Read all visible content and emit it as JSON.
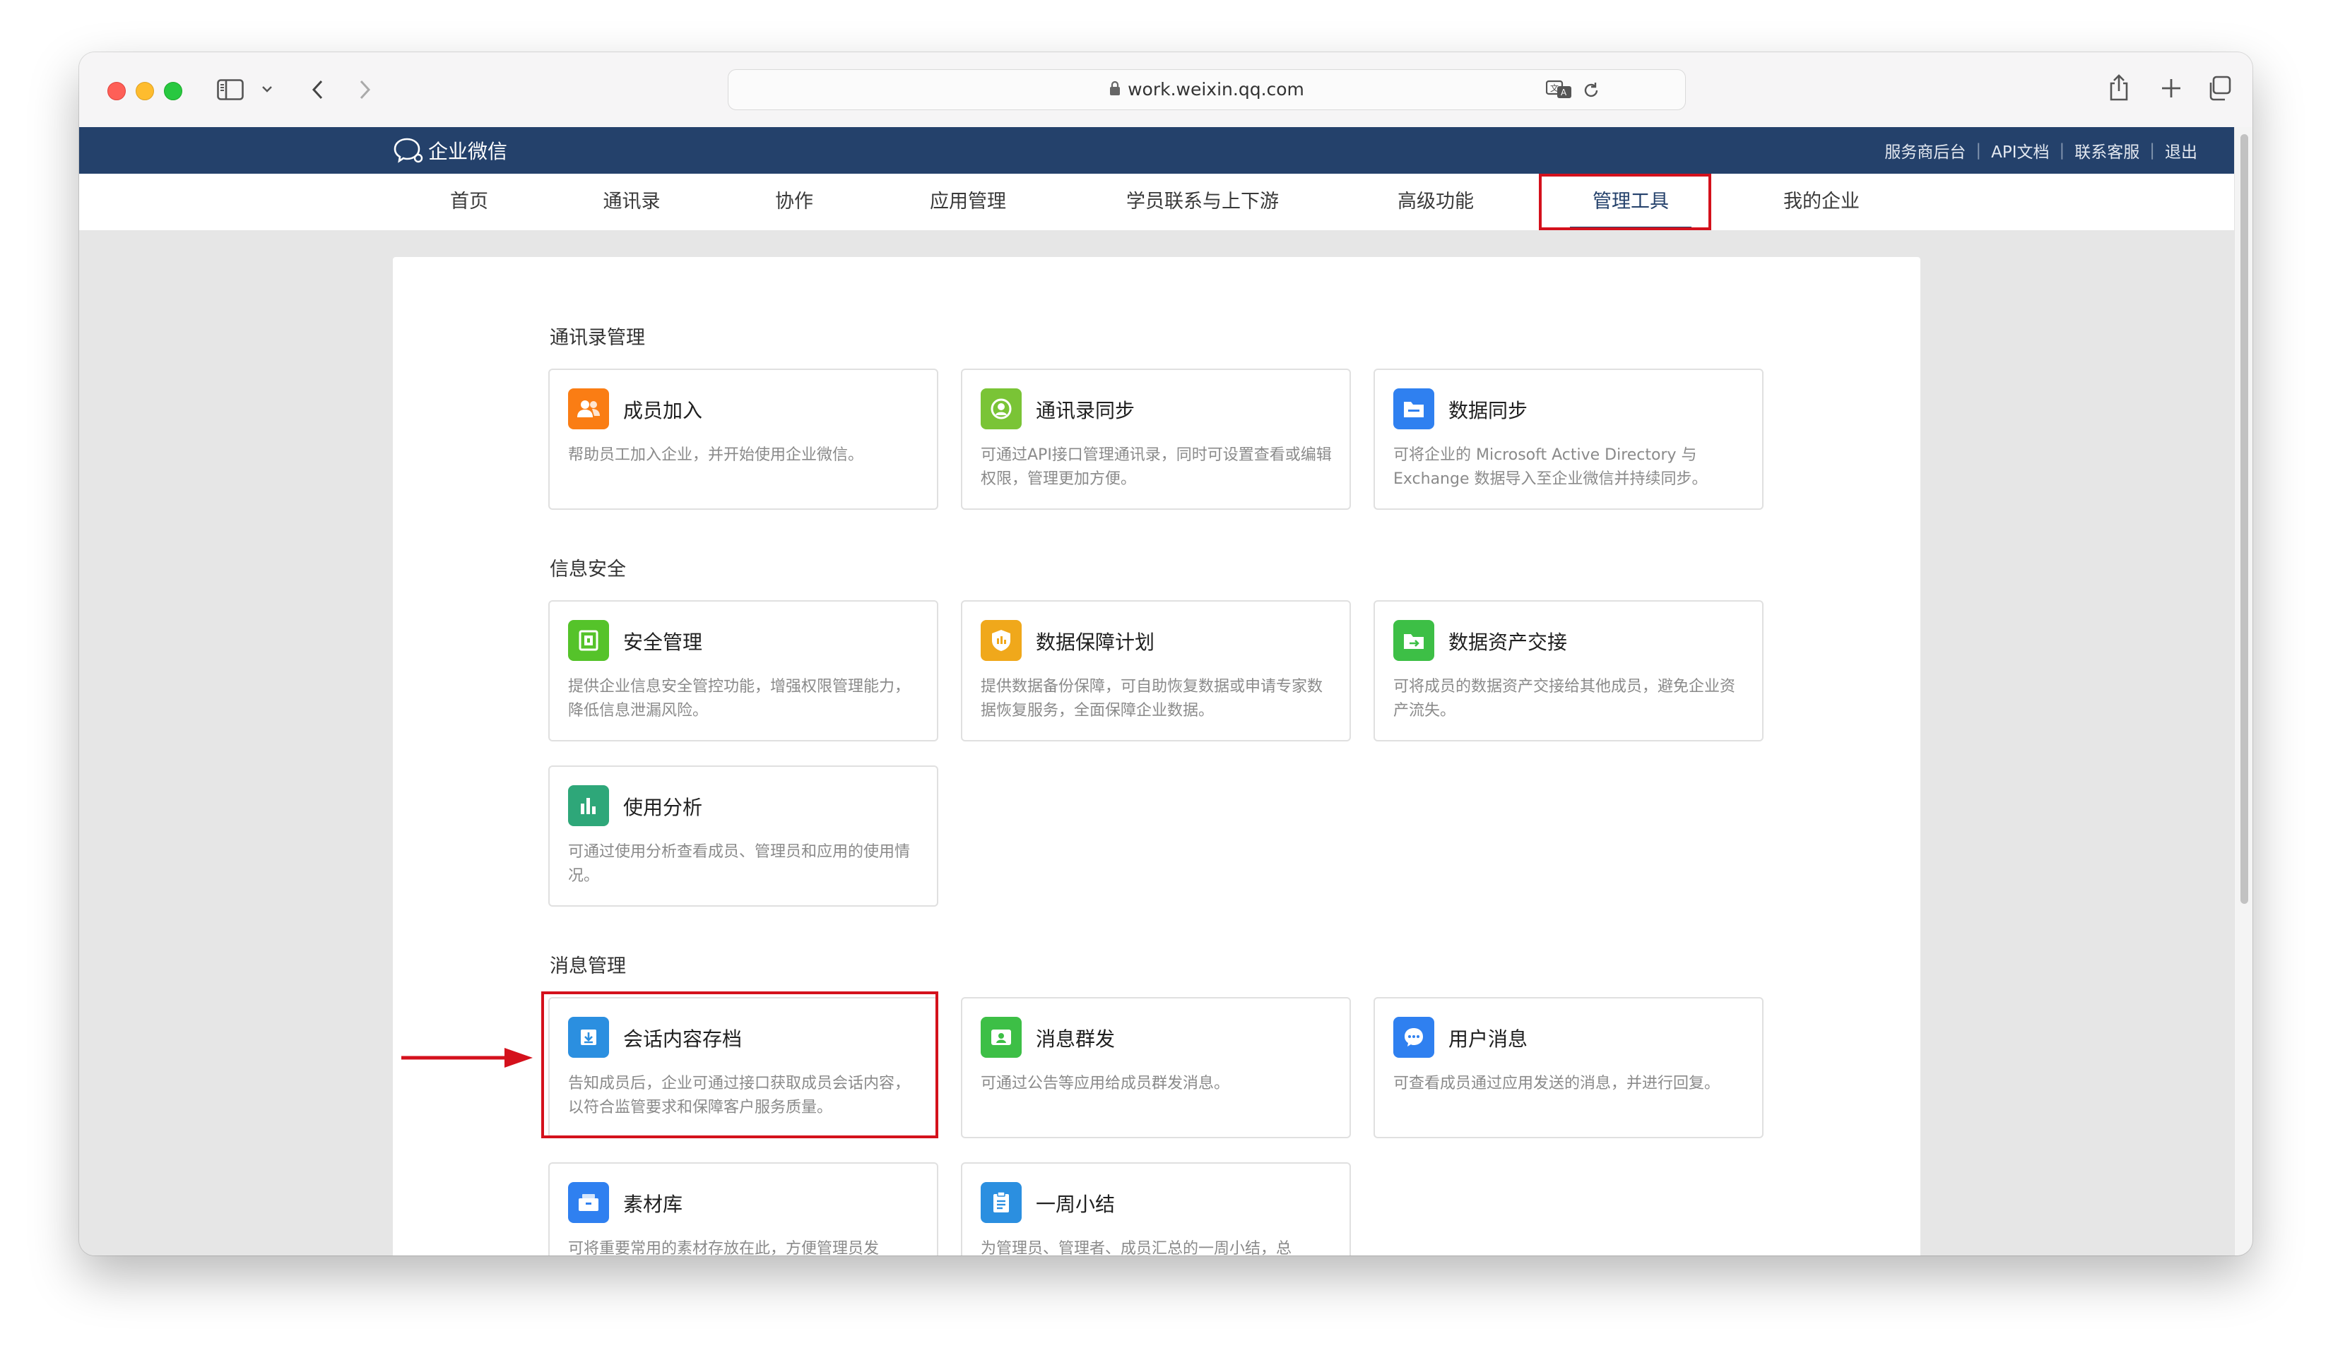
{
  "browser": {
    "url": "work.weixin.qq.com"
  },
  "site": {
    "brand": "企业微信",
    "top_links": [
      "服务商后台",
      "API文档",
      "联系客服",
      "退出"
    ],
    "nav": [
      "首页",
      "通讯录",
      "协作",
      "应用管理",
      "学员联系与上下游",
      "高级功能",
      "管理工具",
      "我的企业"
    ],
    "active_nav": "管理工具"
  },
  "sections": [
    {
      "title": "通讯录管理",
      "cards": [
        {
          "title": "成员加入",
          "desc": "帮助员工加入企业，并开始使用企业微信。",
          "icon": "member-join-icon",
          "color": "#fa7d14"
        },
        {
          "title": "通讯录同步",
          "desc": "可通过API接口管理通讯录，同时可设置查看或编辑权限，管理更加方便。",
          "icon": "contacts-sync-icon",
          "color": "#7ac436"
        },
        {
          "title": "数据同步",
          "desc": "可将企业的 Microsoft Active Directory 与 Exchange 数据导入至企业微信并持续同步。",
          "icon": "data-sync-icon",
          "color": "#2f80f0"
        }
      ]
    },
    {
      "title": "信息安全",
      "cards": [
        {
          "title": "安全管理",
          "desc": "提供企业信息安全管控功能，增强权限管理能力，降低信息泄漏风险。",
          "icon": "security-icon",
          "color": "#55c32a"
        },
        {
          "title": "数据保障计划",
          "desc": "提供数据备份保障，可自助恢复数据或申请专家数据恢复服务，全面保障企业数据。",
          "icon": "data-protection-icon",
          "color": "#f0a81b"
        },
        {
          "title": "数据资产交接",
          "desc": "可将成员的数据资产交接给其他成员，避免企业资产流失。",
          "icon": "asset-handover-icon",
          "color": "#3dbf46"
        },
        {
          "title": "使用分析",
          "desc": "可通过使用分析查看成员、管理员和应用的使用情况。",
          "icon": "usage-analysis-icon",
          "color": "#2ea779"
        }
      ]
    },
    {
      "title": "消息管理",
      "cards": [
        {
          "title": "会话内容存档",
          "desc": "告知成员后，企业可通过接口获取成员会话内容，以符合监管要求和保障客户服务质量。",
          "icon": "chat-archive-icon",
          "color": "#2b8fe0"
        },
        {
          "title": "消息群发",
          "desc": "可通过公告等应用给成员群发消息。",
          "icon": "mass-message-icon",
          "color": "#3dbf46"
        },
        {
          "title": "用户消息",
          "desc": "可查看成员通过应用发送的消息，并进行回复。",
          "icon": "user-message-icon",
          "color": "#2f80f0"
        },
        {
          "title": "素材库",
          "desc": "可将重要常用的素材存放在此，方便管理员发",
          "icon": "material-library-icon",
          "color": "#2f80f0"
        },
        {
          "title": "一周小结",
          "desc": "为管理员、管理者、成员汇总的一周小结，总",
          "icon": "weekly-summary-icon",
          "color": "#2b8fe0"
        }
      ]
    }
  ]
}
